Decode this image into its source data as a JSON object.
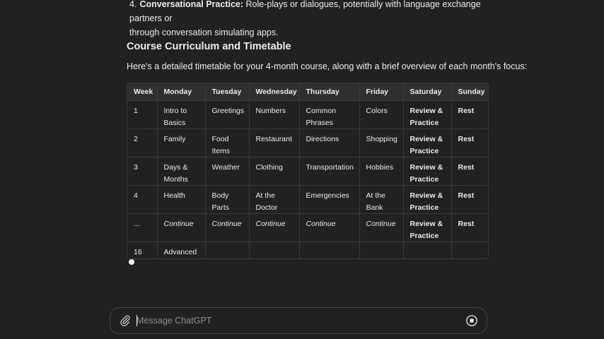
{
  "list_item": {
    "number": "4.",
    "title": "Conversational Practice:",
    "text_line1": " Role-plays or dialogues, potentially with language exchange partners or",
    "text_line2": "through conversation simulating apps."
  },
  "section": {
    "heading": "Course Curriculum and Timetable",
    "intro": "Here's a detailed timetable for your 4-month course, along with a brief overview of each month's focus:"
  },
  "table": {
    "headers": [
      "Week",
      "Monday",
      "Tuesday",
      "Wednesday",
      "Thursday",
      "Friday",
      "Saturday",
      "Sunday"
    ],
    "rows": [
      [
        "1",
        "Intro to Basics",
        "Greetings",
        "Numbers",
        "Common Phrases",
        "Colors",
        "Review & Practice",
        "Rest"
      ],
      [
        "2",
        "Family",
        "Food Items",
        "Restaurant",
        "Directions",
        "Shopping",
        "Review & Practice",
        "Rest"
      ],
      [
        "3",
        "Days & Months",
        "Weather",
        "Clothing",
        "Transportation",
        "Hobbies",
        "Review & Practice",
        "Rest"
      ],
      [
        "4",
        "Health",
        "Body Parts",
        "At the Doctor",
        "Emergencies",
        "At the Bank",
        "Review & Practice",
        "Rest"
      ],
      [
        "...",
        "Continue",
        "Continue",
        "Continue",
        "Continue",
        "Continue",
        "Review & Practice",
        "Rest"
      ],
      [
        "16",
        "Advanced",
        "",
        "",
        "",
        "",
        "",
        ""
      ]
    ]
  },
  "composer": {
    "placeholder": "Message ChatGPT",
    "value": ""
  },
  "icons": {
    "attach": "paperclip-icon",
    "stop": "stop-generating-icon"
  }
}
